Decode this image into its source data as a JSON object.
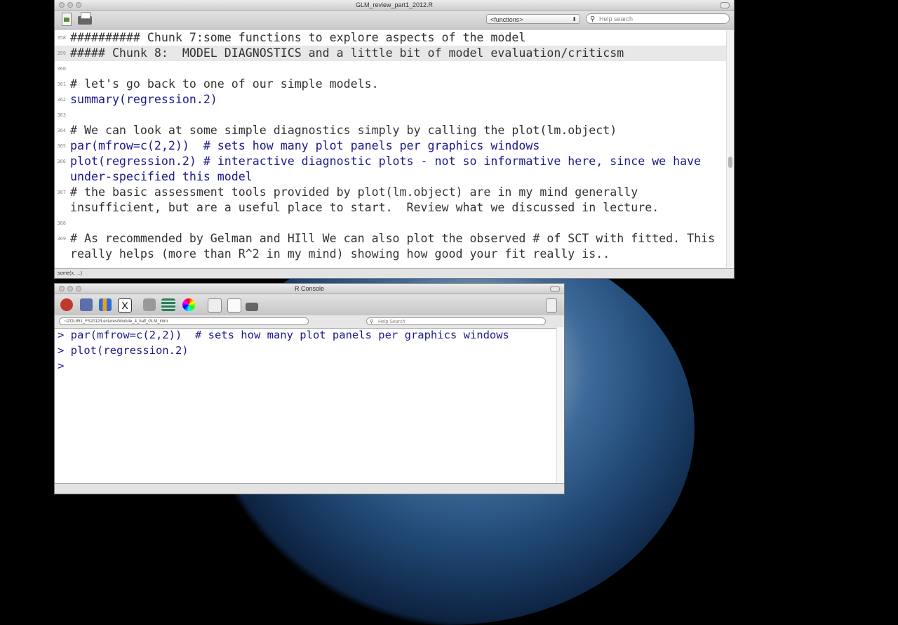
{
  "editor": {
    "title": "GLM_review_part1_2012.R",
    "functions_label": "<functions>",
    "search_placeholder": "Help search",
    "status": "some(x, ...)",
    "lines": [
      {
        "num": "358",
        "text": "########## Chunk 7:some functions to explore aspects of the model",
        "kind": "comment"
      },
      {
        "num": "359",
        "text": "##### Chunk 8:  MODEL DIAGNOSTICS and a little bit of model evaluation/criticsm",
        "kind": "comment",
        "hl": true
      },
      {
        "num": "360",
        "text": "",
        "kind": "comment"
      },
      {
        "num": "361",
        "text": "# let's go back to one of our simple models.",
        "kind": "comment"
      },
      {
        "num": "362",
        "text": "summary(regression.2)",
        "kind": "code"
      },
      {
        "num": "363",
        "text": "",
        "kind": "comment"
      },
      {
        "num": "364",
        "text": "# We can look at some simple diagnostics simply by calling the plot(lm.object)",
        "kind": "comment"
      },
      {
        "num": "365",
        "text": "par(mfrow=c(2,2))  # sets how many plot panels per graphics windows",
        "kind": "code"
      },
      {
        "num": "366",
        "text": "plot(regression.2) # interactive diagnostic plots - not so informative here, since we have under-specified this model",
        "kind": "code"
      },
      {
        "num": "367",
        "text": "# the basic assessment tools provided by plot(lm.object) are in my mind generally insufficient, but are a useful place to start.  Review what we discussed in lecture.",
        "kind": "comment"
      },
      {
        "num": "368",
        "text": "",
        "kind": "comment"
      },
      {
        "num": "369",
        "text": "# As recommended by Gelman and HIll We can also plot the observed # of SCT with fitted. This really helps (more than R^2 in my mind) showing how good your fit really is..",
        "kind": "comment"
      }
    ]
  },
  "console": {
    "title": "R Console",
    "path": "~/ZOL851_FS2012/Lectures/Module_4_half_GLM_intro",
    "search_placeholder": "Help Search",
    "lines": [
      "> par(mfrow=c(2,2))  # sets how many plot panels per graphics windows",
      "> plot(regression.2)",
      ">"
    ]
  }
}
